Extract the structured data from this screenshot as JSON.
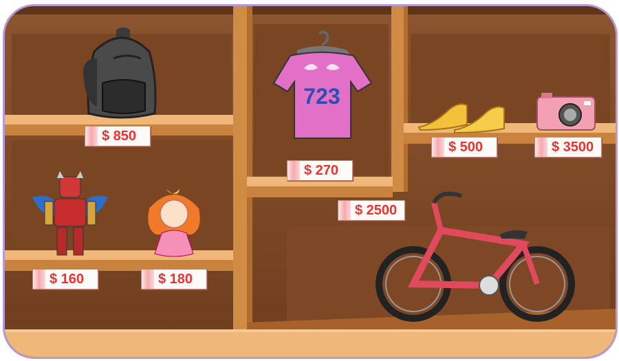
{
  "scene": "toy and goods shop shelves",
  "colors": {
    "frame_border": "#b49ad6",
    "shelf_wood": "#e3a25c",
    "back_wall": "#7c4623",
    "price_text": "#ee3131"
  },
  "items": [
    {
      "name": "backpack",
      "icon": "backpack-icon",
      "price": "$ 850"
    },
    {
      "name": "t-shirt",
      "icon": "t-shirt-icon",
      "shirt_text": "723",
      "price": "$ 270"
    },
    {
      "name": "shoes",
      "icon": "shoes-icon",
      "price": "$ 500"
    },
    {
      "name": "camera",
      "icon": "camera-icon",
      "price": "$ 3500"
    },
    {
      "name": "robot",
      "icon": "robot-toy-icon",
      "price": "$ 160"
    },
    {
      "name": "doll",
      "icon": "doll-icon",
      "price": "$ 180"
    },
    {
      "name": "bicycle",
      "icon": "bicycle-icon",
      "price": "$ 2500"
    }
  ]
}
